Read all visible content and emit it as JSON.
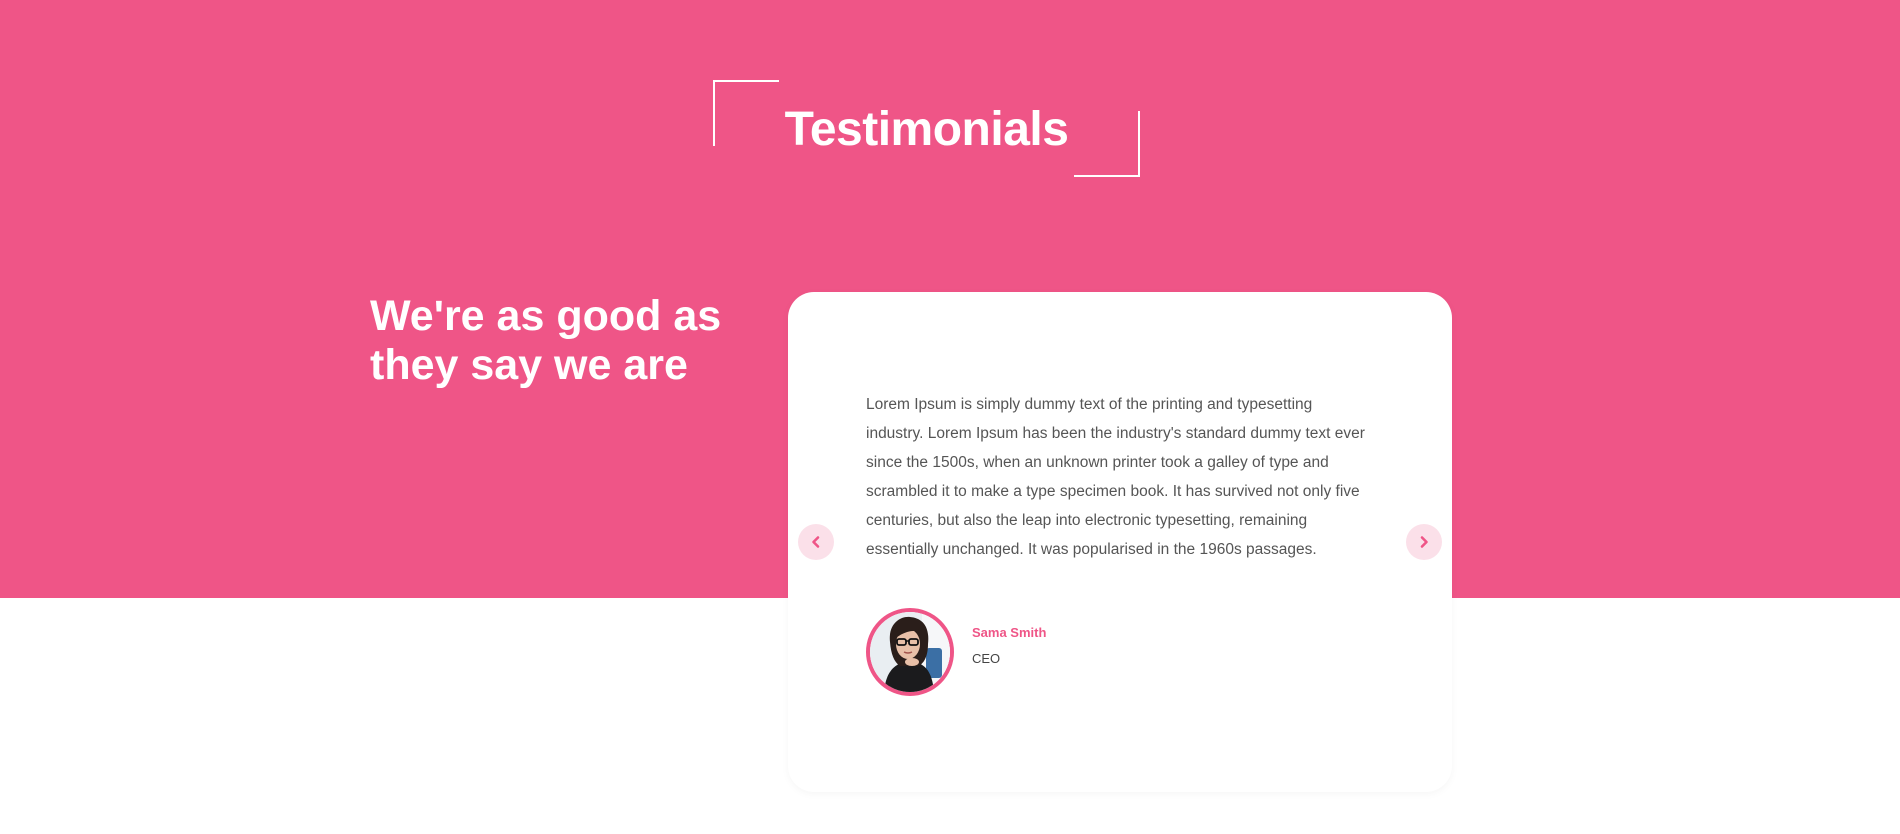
{
  "section": {
    "title": "Testimonials",
    "tagline": "We're as good as they say we are"
  },
  "testimonial": {
    "quote": "Lorem Ipsum is simply dummy text of the printing and typesetting industry. Lorem Ipsum has been the industry's standard dummy text ever since the 1500s, when an unknown printer took a galley of type and scrambled it to make a type specimen book. It has survived not only five centuries, but also the leap into electronic typesetting, remaining essentially unchanged. It was popularised in the 1960s passages.",
    "author_name": "Sama Smith",
    "author_role": "CEO"
  },
  "carousel": {
    "prev_icon": "chevron-left-icon",
    "next_icon": "chevron-right-icon"
  },
  "colors": {
    "accent": "#ef5587",
    "nav_button_bg": "#fbe0e9",
    "background": "#ffffff"
  }
}
